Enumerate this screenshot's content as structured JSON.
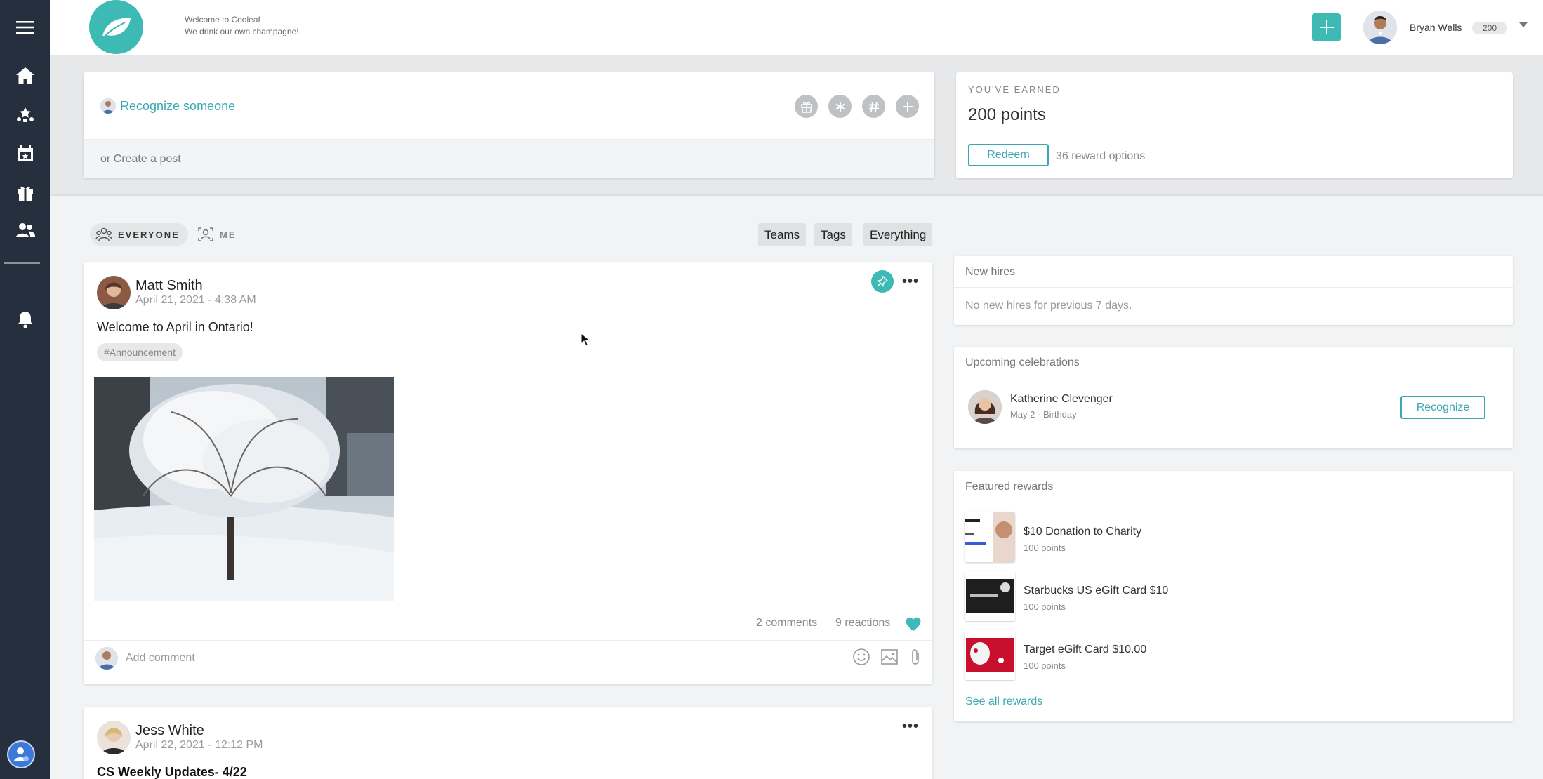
{
  "header": {
    "welcome_line1": "Welcome to Cooleaf",
    "welcome_line2": "We drink our own champagne!",
    "user_name": "Bryan Wells",
    "user_points": "200"
  },
  "sidebar": {
    "items": [
      {
        "icon": "menu-icon"
      },
      {
        "icon": "home-icon"
      },
      {
        "icon": "recognition-icon"
      },
      {
        "icon": "calendar-icon"
      },
      {
        "icon": "gift-icon"
      },
      {
        "icon": "people-icon"
      },
      {
        "icon": "bell-icon"
      }
    ]
  },
  "composer": {
    "recognize_label": "Recognize someone",
    "create_post_label": "or Create a post",
    "tools": [
      "gift-icon",
      "asterisk-icon",
      "hashtag-icon",
      "plus-icon"
    ]
  },
  "earned": {
    "label": "YOU'VE EARNED",
    "points": "200 points",
    "redeem_label": "Redeem",
    "reward_options": "36 reward options"
  },
  "filters": {
    "everyone": "EVERYONE",
    "me": "ME",
    "teams": "Teams",
    "tags": "Tags",
    "everything": "Everything"
  },
  "posts": [
    {
      "author": "Matt Smith",
      "date": "April 21, 2021 - 4:38 AM",
      "text": "Welcome to April in Ontario!",
      "tag": "#Announcement",
      "comments": "2 comments",
      "reactions": "9 reactions",
      "comment_placeholder": "Add comment"
    },
    {
      "author": "Jess White",
      "date": "April 22, 2021 - 12:12 PM",
      "text": "CS Weekly Updates- 4/22"
    }
  ],
  "widgets": {
    "new_hires": {
      "title": "New hires",
      "empty": "No new hires for previous 7 days."
    },
    "celebrations": {
      "title": "Upcoming celebrations",
      "name": "Katherine Clevenger",
      "detail": "May 2 · Birthday",
      "button": "Recognize"
    },
    "rewards": {
      "title": "Featured rewards",
      "items": [
        {
          "name": "$10 Donation to Charity",
          "points": "100 points"
        },
        {
          "name": "Starbucks US eGift Card $10",
          "points": "100 points"
        },
        {
          "name": "Target eGift Card $10.00",
          "points": "100 points"
        }
      ],
      "see_all": "See all rewards"
    }
  },
  "colors": {
    "accent": "#3dbab3",
    "link": "#3aa8b4",
    "sidebar": "#262f3d"
  }
}
